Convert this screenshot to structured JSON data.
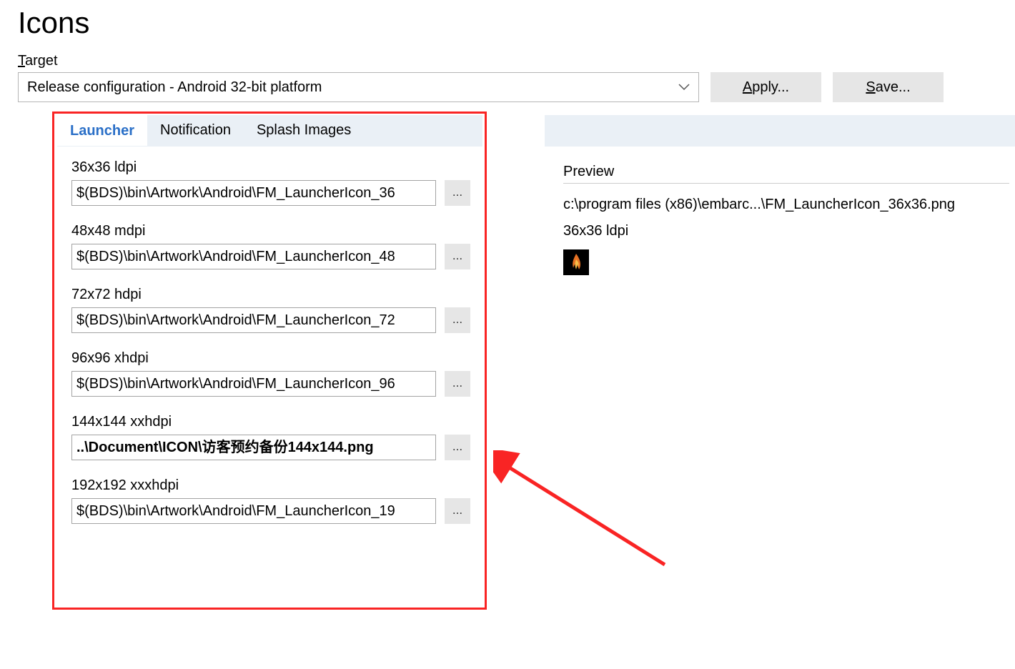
{
  "page_title": "Icons",
  "target": {
    "label": "Target",
    "value": "Release configuration - Android 32-bit platform"
  },
  "buttons": {
    "apply": "Apply...",
    "save": "Save..."
  },
  "tabs": {
    "launcher": "Launcher",
    "notification": "Notification",
    "splash": "Splash Images"
  },
  "icons": [
    {
      "label": "36x36 ldpi",
      "path": "$(BDS)\\bin\\Artwork\\Android\\FM_LauncherIcon_36",
      "bold": false
    },
    {
      "label": "48x48 mdpi",
      "path": "$(BDS)\\bin\\Artwork\\Android\\FM_LauncherIcon_48",
      "bold": false
    },
    {
      "label": "72x72 hdpi",
      "path": "$(BDS)\\bin\\Artwork\\Android\\FM_LauncherIcon_72",
      "bold": false
    },
    {
      "label": "96x96 xhdpi",
      "path": "$(BDS)\\bin\\Artwork\\Android\\FM_LauncherIcon_96",
      "bold": false
    },
    {
      "label": "144x144 xxhdpi",
      "path": "..\\Document\\ICON\\访客预约备份144x144.png",
      "bold": true
    },
    {
      "label": "192x192 xxxhdpi",
      "path": "$(BDS)\\bin\\Artwork\\Android\\FM_LauncherIcon_19",
      "bold": false
    }
  ],
  "preview": {
    "heading": "Preview",
    "path": "c:\\program files (x86)\\embarc...\\FM_LauncherIcon_36x36.png",
    "size": "36x36 ldpi"
  },
  "browse_label": "..."
}
